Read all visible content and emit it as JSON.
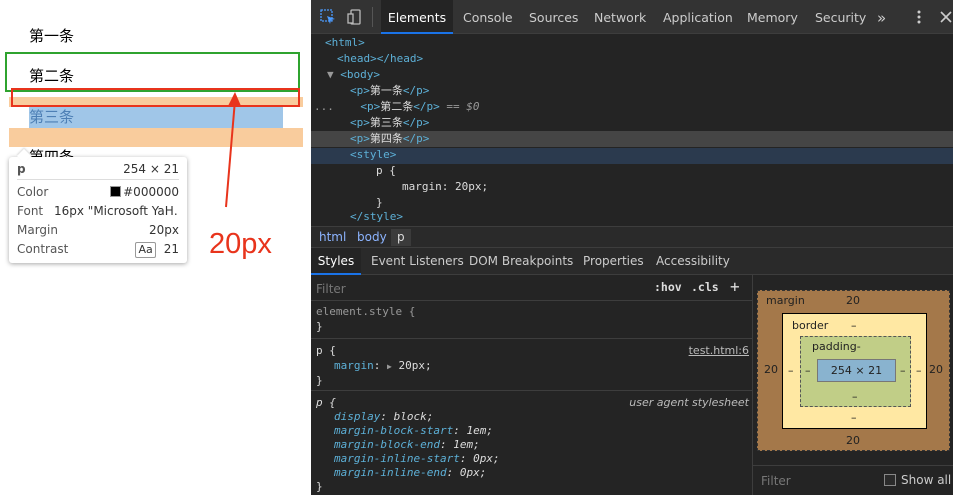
{
  "page": {
    "paragraphs": [
      "第一条",
      "第二条",
      "第三条",
      "第四条"
    ],
    "annotation": "20px",
    "tooltip": {
      "tag": "p",
      "size": "254 × 21",
      "color_label": "Color",
      "color_value": "#000000",
      "font_label": "Font",
      "font_value": "16px \"Microsoft YaH…",
      "margin_label": "Margin",
      "margin_value": "20px",
      "contrast_label": "Contrast",
      "contrast_badge": "Aa",
      "contrast_value": "21"
    }
  },
  "devtools": {
    "tabs": [
      "Elements",
      "Console",
      "Sources",
      "Network",
      "Application",
      "Memory",
      "Security"
    ],
    "more": "»",
    "dom": {
      "html_open": "<html>",
      "head": "<head></head>",
      "body_open": "<body>",
      "p_open": "<p>",
      "p_close": "</p>",
      "texts": [
        "第一条",
        "第二条",
        "第三条",
        "第四条"
      ],
      "selected_marker": "== $0",
      "ellipsis": "...",
      "style_open": "<style>",
      "css_selector": "p {",
      "css_decl": "margin: 20px;",
      "css_close": "}",
      "style_close": "</style>"
    },
    "breadcrumbs": [
      "html",
      "body",
      "p"
    ],
    "subtabs": [
      "Styles",
      "Event Listeners",
      "DOM Breakpoints",
      "Properties",
      "Accessibility"
    ],
    "filter_placeholder": "Filter",
    "hov": ":hov",
    "cls": ".cls",
    "plus": "+",
    "rules": {
      "element_style": "element.style {",
      "close": "}",
      "p_selector": "p {",
      "p_source": "test.html:6",
      "p_prop": "margin",
      "p_val": "20px;",
      "ua_selector": "p {",
      "ua_source": "user agent stylesheet",
      "ua_props": [
        {
          "name": "display",
          "value": "block;"
        },
        {
          "name": "margin-block-start",
          "value": "1em;"
        },
        {
          "name": "margin-block-end",
          "value": "1em;"
        },
        {
          "name": "margin-inline-start",
          "value": "0px;"
        },
        {
          "name": "margin-inline-end",
          "value": "0px;"
        }
      ]
    },
    "box_model": {
      "margin_label": "margin",
      "margin_top": "20",
      "margin_bottom": "20",
      "margin_left": "20",
      "margin_right": "20",
      "border_label": "border",
      "border_top": "–",
      "border_bottom": "–",
      "border_left": "–",
      "border_right": "–",
      "padding_label": "padding-",
      "padding_bottom": "–",
      "padding_left": "–",
      "padding_right": "–",
      "content": "254 × 21"
    },
    "computed_filter": "Filter",
    "show_all": "Show all"
  }
}
